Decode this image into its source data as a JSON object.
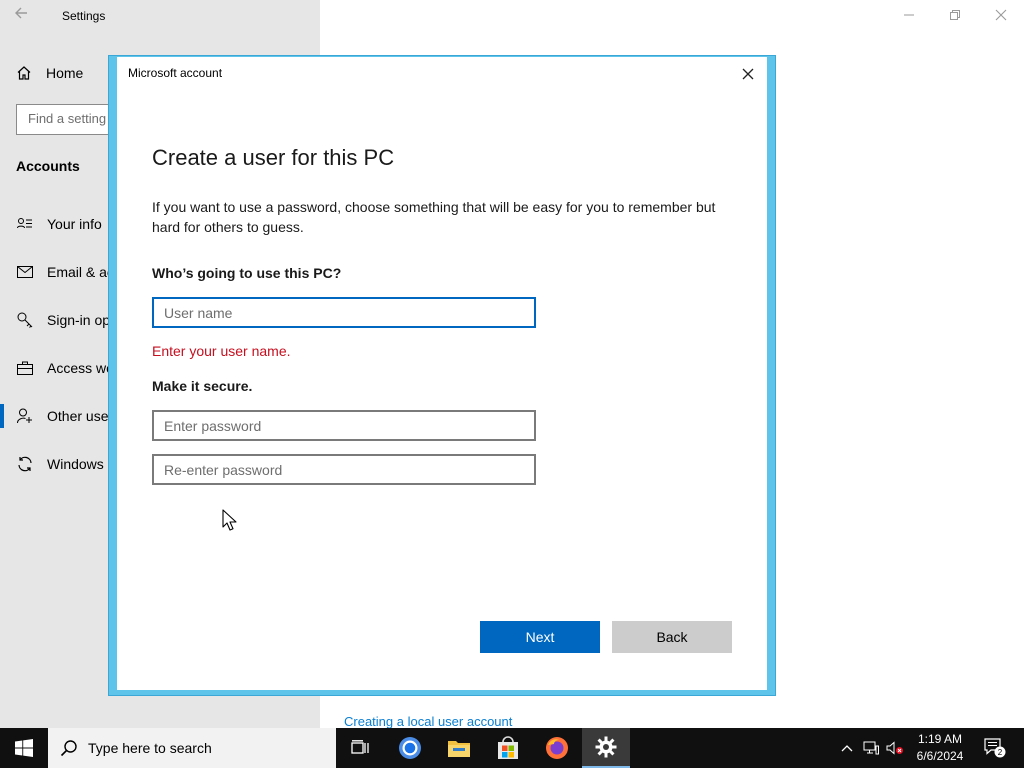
{
  "settings": {
    "title": "Settings",
    "home_label": "Home",
    "search_placeholder": "Find a setting",
    "section_heading": "Accounts",
    "nav_items": [
      {
        "label": "Your info",
        "icon": "person-card-icon"
      },
      {
        "label": "Email & accounts",
        "icon": "mail-icon"
      },
      {
        "label": "Sign-in options",
        "icon": "key-icon"
      },
      {
        "label": "Access work or school",
        "icon": "briefcase-icon"
      },
      {
        "label": "Other users",
        "icon": "person-add-icon",
        "selected": true
      },
      {
        "label": "Windows backup",
        "icon": "sync-icon"
      }
    ],
    "visible_nav_text": [
      "Your info",
      "Email & ac",
      "Sign-in op",
      "Access wo",
      "Other use",
      "Windows"
    ],
    "local_account_link": "Creating a local user account"
  },
  "dialog": {
    "window_title": "Microsoft account",
    "heading": "Create a user for this PC",
    "description": "If you want to use a password, choose something that will be easy for you to remember but hard for others to guess.",
    "who_label": "Who’s going to use this PC?",
    "username_placeholder": "User name",
    "username_value": "",
    "error_text": "Enter your user name.",
    "secure_label": "Make it secure.",
    "password_placeholder": "Enter password",
    "reenter_placeholder": "Re-enter password",
    "next_label": "Next",
    "back_label": "Back"
  },
  "taskbar": {
    "search_placeholder": "Type here to search",
    "apps": [
      "task-view",
      "chrome",
      "file-explorer",
      "microsoft-store",
      "firefox",
      "settings"
    ],
    "time": "1:19 AM",
    "date": "6/6/2024",
    "notification_count": "2"
  },
  "colors": {
    "accent": "#0067c0",
    "error": "#c50f1f",
    "dialog_frame": "#5fc4ea",
    "link": "#0a7fd1"
  }
}
